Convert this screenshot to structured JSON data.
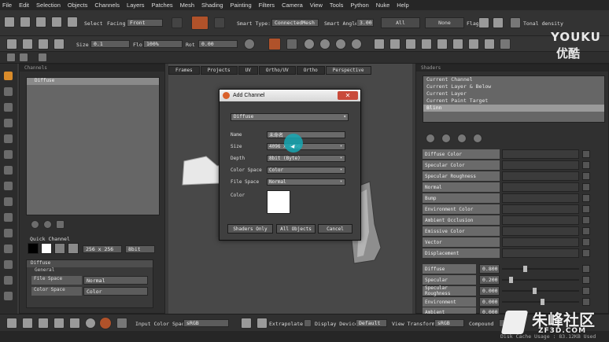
{
  "menu": [
    "File",
    "Edit",
    "Selection",
    "Objects",
    "Channels",
    "Layers",
    "Patches",
    "Mesh",
    "Shading",
    "Painting",
    "Filters",
    "Camera",
    "View",
    "Tools",
    "Python",
    "Nuke",
    "Help"
  ],
  "toolbar1": {
    "select_label": "Select",
    "facing_label": "Facing",
    "facing_value": "Front",
    "smart_type_label": "Smart Type:",
    "smart_type_value": "ConnectedMesh",
    "smart_angle_label": "Smart Angle",
    "smart_angle_value": "3.00",
    "all_label": "All",
    "none_label": "None",
    "flag_label": "Flag",
    "tonal_density_label": "Tonal density"
  },
  "toolbar2": {
    "size_label": "Size",
    "size_value": "0.1",
    "flow_label": "Flo",
    "flow_value": "100%",
    "rot_label": "Rot",
    "rot_value": "0.00"
  },
  "viewport_tabs": [
    "Frames",
    "Projects",
    "UV",
    "Ortho/UV",
    "Ortho",
    "Perspective"
  ],
  "channels_panel": {
    "title": "Channels",
    "selected_channel": "Diffuse",
    "quick_channel_label": "Quick Channel",
    "quick_size_value": "256 x 256",
    "quick_depth_value": "8bit",
    "layer_name": "Diffuse",
    "general_label": "General",
    "file_space_label": "File Space",
    "file_space_value": "Normal",
    "color_space_label": "Color Space",
    "color_space_value": "Color"
  },
  "shader_panel": {
    "title": "Shaders",
    "list": [
      "Current Channel",
      "Current Layer & Below",
      "Current Layer",
      "Current Paint Target",
      "Blinn"
    ],
    "selected_index": 4,
    "attributes": [
      "Diffuse Color",
      "Specular Color",
      "Specular Roughness",
      "Normal",
      "Bump",
      "Environment Color",
      "Ambient Occlusion",
      "Emissive Color",
      "Vector",
      "Displacement"
    ],
    "sliders": [
      {
        "label": "Diffuse",
        "value": "0.800"
      },
      {
        "label": "Specular",
        "value": "0.200"
      },
      {
        "label": "Specular Roughness",
        "value": "0.000"
      },
      {
        "label": "Environment",
        "value": "0.000"
      },
      {
        "label": "Ambient",
        "value": "0.000"
      }
    ]
  },
  "dialog": {
    "title": "Add Channel",
    "channel_select": "Diffuse",
    "name_label": "Name",
    "name_value": "未命名",
    "size_label": "Size",
    "size_value": "4096 x 4096",
    "depth_label": "Depth",
    "depth_value": "8bit (Byte)",
    "color_space_label": "Color Space",
    "color_space_value": "Color",
    "file_space_label": "File Space",
    "file_space_value": "Normal",
    "color_label": "Color",
    "color_swatch": "#ffffff",
    "btn_shaders_only": "Shaders Only",
    "btn_all_objects": "All Objects",
    "btn_cancel": "Cancel"
  },
  "bottom": {
    "input_color_space_label": "Input Color Space",
    "input_color_space_value": "sRGB",
    "extrapolate_label": "Extrapolate",
    "display_device_label": "Display Device",
    "display_device_value": "Default",
    "view_transform_label": "View Transform",
    "view_transform_value": "sRGB",
    "compound_label": "Compound"
  },
  "status": {
    "disk_cache": "Disk Cache Usage : 83.12KB Used"
  },
  "watermarks": {
    "youku_en": "YOUKU",
    "youku_cn": "优酷",
    "zf3d_cn": "朱峰社区",
    "zf3d_en": "ZF3D.COM"
  },
  "colors": {
    "accent_orange": "#d9612b",
    "cursor_cyan": "#16a8b4",
    "dialog_title": "#e6e6e6"
  }
}
